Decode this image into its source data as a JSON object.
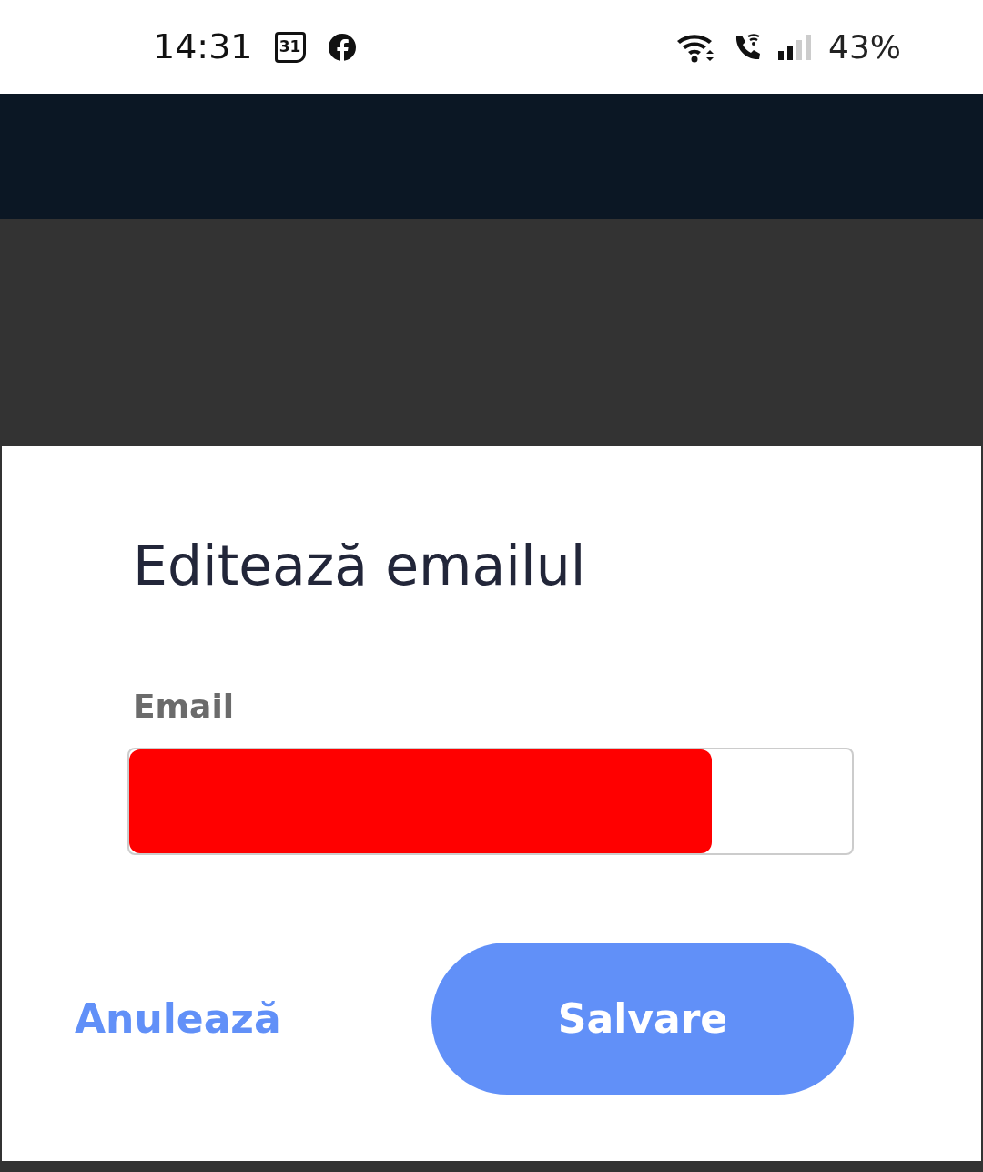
{
  "status_bar": {
    "time": "14:31",
    "calendar_day": "31",
    "battery": "43%"
  },
  "dialog": {
    "title": "Editează emailul",
    "field": {
      "label": "Email",
      "redacted": true
    },
    "buttons": [
      {
        "label": "Anulează",
        "kind": "text"
      },
      {
        "label": "Salvare",
        "kind": "filled"
      }
    ]
  }
}
